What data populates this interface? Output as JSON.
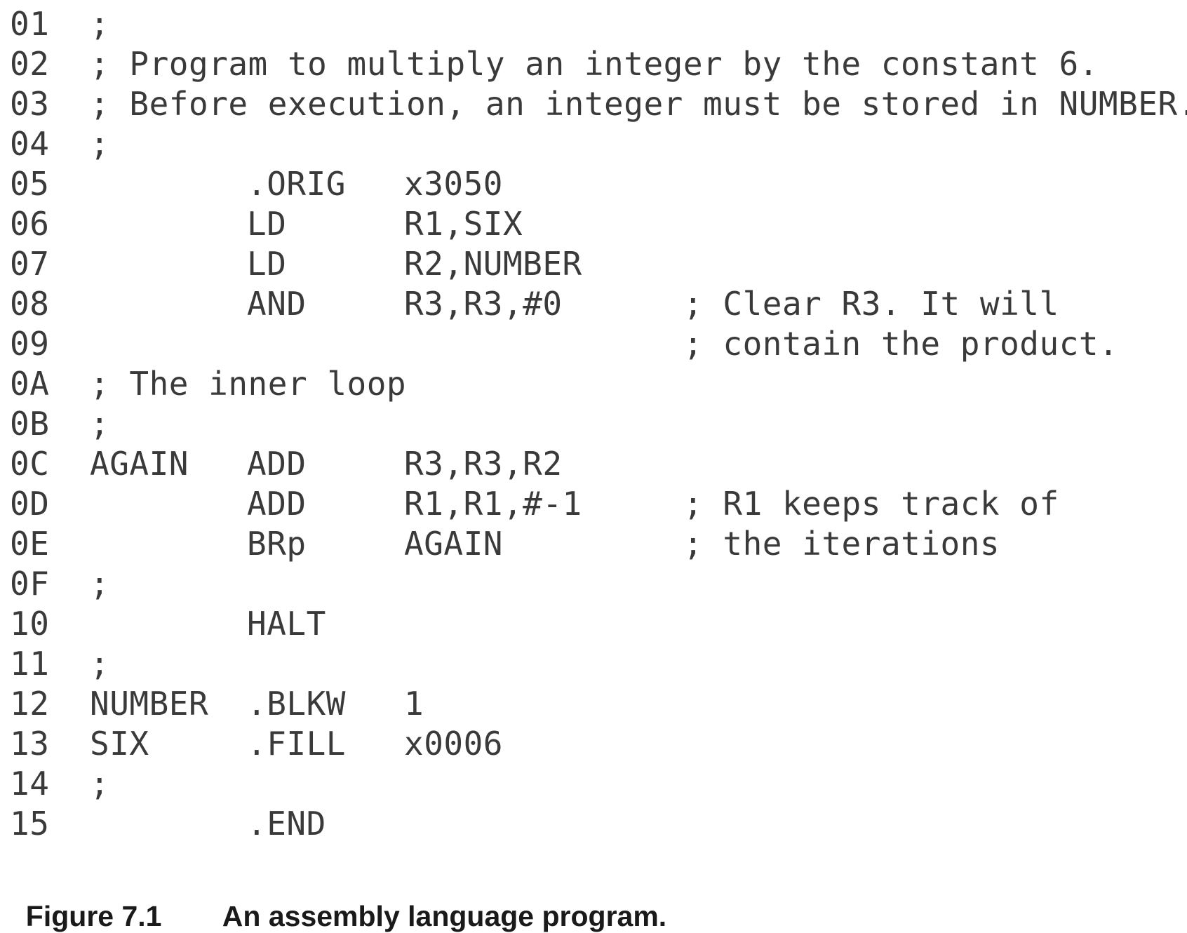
{
  "listing": [
    {
      "ln": "01",
      "col1": ";",
      "op": "",
      "arg": "",
      "comment": ""
    },
    {
      "ln": "02",
      "col1": "; Program to multiply an integer by the constant 6.",
      "op": "",
      "arg": "",
      "comment": ""
    },
    {
      "ln": "03",
      "col1": "; Before execution, an integer must be stored in NUMBER.",
      "op": "",
      "arg": "",
      "comment": ""
    },
    {
      "ln": "04",
      "col1": ";",
      "op": "",
      "arg": "",
      "comment": ""
    },
    {
      "ln": "05",
      "col1": "",
      "op": ".ORIG",
      "arg": "x3050",
      "comment": ""
    },
    {
      "ln": "06",
      "col1": "",
      "op": "LD",
      "arg": "R1,SIX",
      "comment": ""
    },
    {
      "ln": "07",
      "col1": "",
      "op": "LD",
      "arg": "R2,NUMBER",
      "comment": ""
    },
    {
      "ln": "08",
      "col1": "",
      "op": "AND",
      "arg": "R3,R3,#0",
      "comment": "; Clear R3. It will"
    },
    {
      "ln": "09",
      "col1": "",
      "op": "",
      "arg": "",
      "comment": "; contain the product."
    },
    {
      "ln": "0A",
      "col1": "; The inner loop",
      "op": "",
      "arg": "",
      "comment": ""
    },
    {
      "ln": "0B",
      "col1": ";",
      "op": "",
      "arg": "",
      "comment": ""
    },
    {
      "ln": "0C",
      "col1": "AGAIN",
      "op": "ADD",
      "arg": "R3,R3,R2",
      "comment": ""
    },
    {
      "ln": "0D",
      "col1": "",
      "op": "ADD",
      "arg": "R1,R1,#-1",
      "comment": "; R1 keeps track of"
    },
    {
      "ln": "0E",
      "col1": "",
      "op": "BRp",
      "arg": "AGAIN",
      "comment": "; the iterations"
    },
    {
      "ln": "0F",
      "col1": ";",
      "op": "",
      "arg": "",
      "comment": ""
    },
    {
      "ln": "10",
      "col1": "",
      "op": "HALT",
      "arg": "",
      "comment": ""
    },
    {
      "ln": "11",
      "col1": ";",
      "op": "",
      "arg": "",
      "comment": ""
    },
    {
      "ln": "12",
      "col1": "NUMBER",
      "op": ".BLKW",
      "arg": "1",
      "comment": ""
    },
    {
      "ln": "13",
      "col1": "SIX",
      "op": ".FILL",
      "arg": "x0006",
      "comment": ""
    },
    {
      "ln": "14",
      "col1": ";",
      "op": "",
      "arg": "",
      "comment": ""
    },
    {
      "ln": "15",
      "col1": "",
      "op": ".END",
      "arg": "",
      "comment": ""
    }
  ],
  "caption": {
    "figure_number": "Figure 7.1",
    "text": "An assembly language program."
  }
}
